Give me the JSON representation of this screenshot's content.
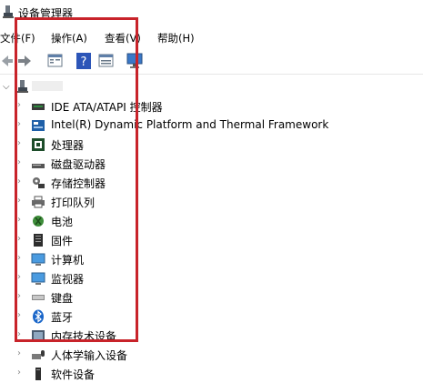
{
  "window": {
    "title": "设备管理器"
  },
  "menu": [
    {
      "label": "文件(F)"
    },
    {
      "label": "操作(A)"
    },
    {
      "label": "查看(V)"
    },
    {
      "label": "帮助(H)"
    }
  ],
  "toolbar": [
    {
      "icon": "back-arrow-icon"
    },
    {
      "icon": "forward-arrow-icon"
    },
    {
      "icon": "properties-icon"
    },
    {
      "icon": "help-icon"
    },
    {
      "icon": "view-icon"
    },
    {
      "icon": "monitor-icon"
    }
  ],
  "tree": {
    "items": [
      {
        "label": "IDE ATA/ATAPI 控制器",
        "icon": "ide-controller-icon"
      },
      {
        "label": "Intel(R) Dynamic Platform and Thermal Framework",
        "icon": "intel-platform-icon"
      },
      {
        "label": "处理器",
        "icon": "processor-icon"
      },
      {
        "label": "磁盘驱动器",
        "icon": "disk-drive-icon"
      },
      {
        "label": "存储控制器",
        "icon": "storage-controller-icon"
      },
      {
        "label": "打印队列",
        "icon": "print-queue-icon"
      },
      {
        "label": "电池",
        "icon": "battery-icon"
      },
      {
        "label": "固件",
        "icon": "firmware-icon"
      },
      {
        "label": "计算机",
        "icon": "computer-icon"
      },
      {
        "label": "监视器",
        "icon": "monitor-icon"
      },
      {
        "label": "键盘",
        "icon": "keyboard-icon"
      },
      {
        "label": "蓝牙",
        "icon": "bluetooth-icon"
      },
      {
        "label": "内存技术设备",
        "icon": "memory-tech-icon"
      },
      {
        "label": "人体学输入设备",
        "icon": "hid-icon"
      },
      {
        "label": "软件设备",
        "icon": "software-device-icon"
      }
    ]
  },
  "colors": {
    "highlight": "#c8232a"
  }
}
